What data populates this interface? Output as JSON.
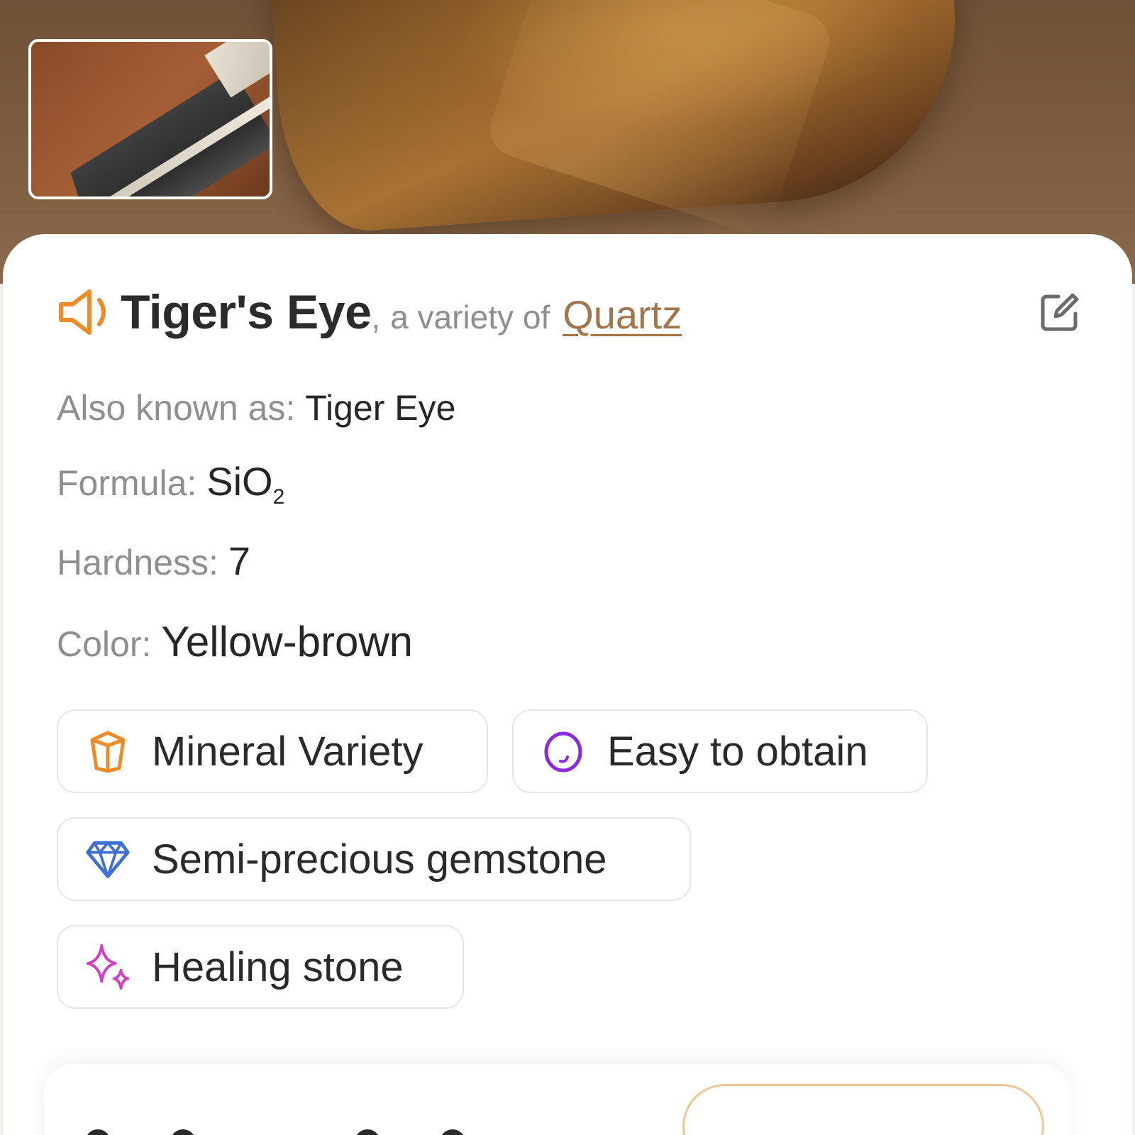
{
  "header": {
    "thumbnail_alt": "Knife comparison photo"
  },
  "title": {
    "name": "Tiger's Eye",
    "separator": ",",
    "variety_prefix": "a variety of",
    "variety_link": "Quartz"
  },
  "info": {
    "aka_label": "Also known as:",
    "aka_value": "Tiger Eye",
    "formula_label": "Formula:",
    "formula_main": "SiO",
    "formula_sub": "2",
    "hardness_label": "Hardness:",
    "hardness_value": "7",
    "color_label": "Color:",
    "color_value": "Yellow-brown"
  },
  "tags": [
    {
      "label": "Mineral Variety",
      "icon": "crystal-icon",
      "color": "#f08a24"
    },
    {
      "label": "Easy to obtain",
      "icon": "pebble-icon",
      "color": "#8a2be2"
    },
    {
      "label": "Semi-precious gemstone",
      "icon": "diamond-icon",
      "color": "#3d6fd6"
    },
    {
      "label": "Healing stone",
      "icon": "sparkles-icon",
      "color": "#d63cc4"
    }
  ],
  "colors": {
    "accent_orange": "#f08a24",
    "link_brown": "#a0774d",
    "label_gray": "#8f8f8f",
    "text_dark": "#262626"
  }
}
